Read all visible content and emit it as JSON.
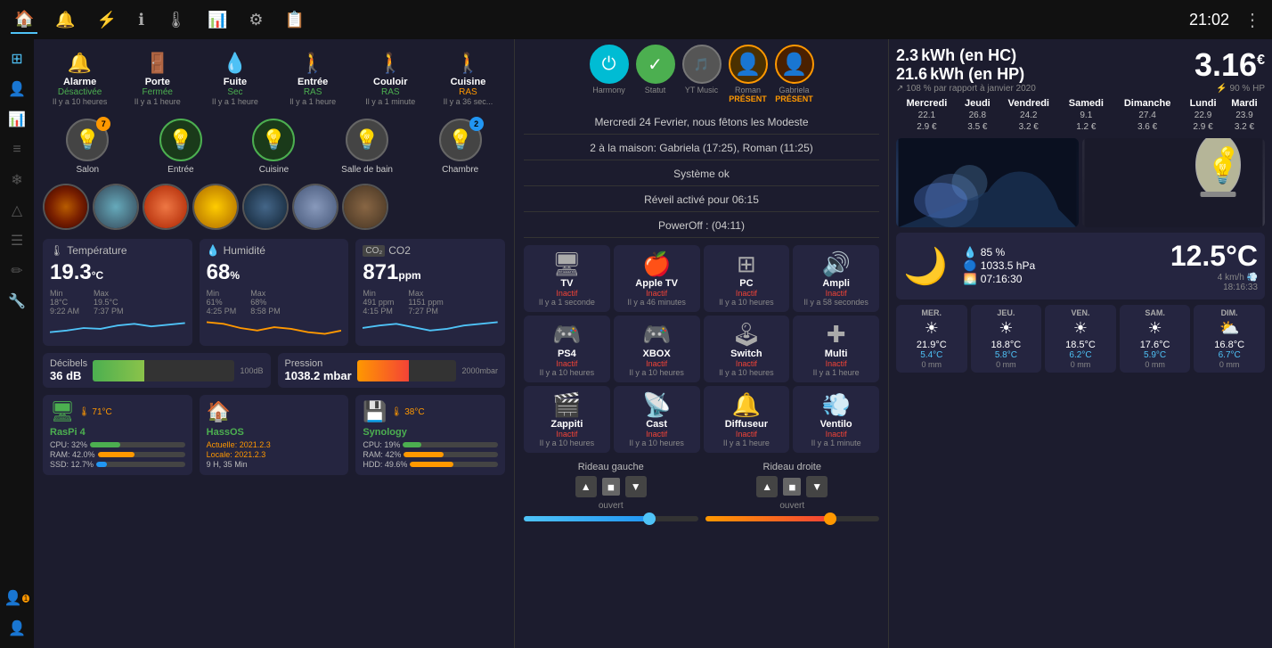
{
  "topnav": {
    "time": "21:02",
    "icons": [
      "🏠",
      "🔔",
      "⚡",
      "ℹ",
      "🌡",
      "📊",
      "⚙",
      "📋"
    ],
    "active_index": 0
  },
  "sidebar": {
    "icons": [
      "⊞",
      "👤",
      "📊",
      "≡",
      "❄",
      "△",
      "☰",
      "✏",
      "🔧",
      "👤2",
      "👤3"
    ]
  },
  "alarms": [
    {
      "icon": "🔔",
      "name": "Alarme",
      "status": "Désactivée",
      "status_class": "green",
      "time": "Il y a 10 heures"
    },
    {
      "icon": "🚪",
      "name": "Porte",
      "status": "Fermée",
      "status_class": "green",
      "time": "Il y a 1 heure"
    },
    {
      "icon": "💧",
      "name": "Fuite",
      "status": "Sec",
      "status_class": "green",
      "time": "Il y a 1 heure"
    },
    {
      "icon": "🚶",
      "name": "Entrée",
      "status": "RAS",
      "status_class": "green",
      "time": "Il y a 1 heure"
    },
    {
      "icon": "🚶",
      "name": "Couloir",
      "status": "RAS",
      "status_class": "green",
      "time": "Il y a 1 minute"
    },
    {
      "icon": "🚶",
      "name": "Cuisine",
      "status": "RAS",
      "status_class": "orange",
      "time": "Il y a 36 sec..."
    }
  ],
  "bulbs": [
    {
      "name": "Salon",
      "badge": "7",
      "badge_class": "orange",
      "lit": false
    },
    {
      "name": "Entrée",
      "badge": "",
      "lit": true
    },
    {
      "name": "Cuisine",
      "badge": "",
      "lit": true
    },
    {
      "name": "Salle de bain",
      "badge": "",
      "lit": false
    },
    {
      "name": "Chambre",
      "badge": "2",
      "badge_class": "blue",
      "lit": false
    }
  ],
  "sensors": {
    "temperature": {
      "title": "Température",
      "icon": "🌡",
      "value": "19.3",
      "unit": "°C",
      "min_val": "18°C",
      "max_val": "19.5°C",
      "min_time": "9:22 AM",
      "max_time": "7:37 PM"
    },
    "humidity": {
      "title": "Humidité",
      "icon": "💧",
      "value": "68",
      "unit": "%",
      "min_val": "61%",
      "max_val": "68%",
      "min_time": "4:25 PM",
      "max_time": "8:58 PM"
    },
    "co2": {
      "title": "CO2",
      "icon": "CO₂",
      "value": "871",
      "unit": "ppm",
      "min_val": "491 ppm",
      "max_val": "1151 ppm",
      "min_time": "4:15 PM",
      "max_time": "7:27 PM"
    }
  },
  "decibels": {
    "label": "Décibels",
    "value": "36 dB",
    "bar_pct": 36,
    "max_label": "100dB"
  },
  "pression": {
    "label": "Pression",
    "value": "1038.2 mbar",
    "bar_pct": 52,
    "max_label": "2000mbar"
  },
  "systems": [
    {
      "name": "RasPi 4",
      "temp": "71°C",
      "temp_icon": "🌡",
      "cpu_label": "CPU: 32%",
      "cpu_pct": 32,
      "cpu_class": "green",
      "ram_label": "RAM: 42.0%",
      "ram_pct": 42,
      "ram_class": "orange",
      "ssd_label": "SSD: 12.7%",
      "ssd_pct": 12,
      "ssd_class": "blue"
    },
    {
      "name": "HassOS",
      "icon": "🏠",
      "line1": "Actuelle: 2021.2.3",
      "line2": "Locale: 2021.2.3",
      "line3": "9 H, 35 Min"
    },
    {
      "name": "Synology",
      "temp": "38°C",
      "temp_icon": "🌡",
      "cpu_label": "CPU: 19%",
      "cpu_pct": 19,
      "cpu_class": "green",
      "ram_label": "RAM: 42%",
      "ram_pct": 42,
      "ram_class": "orange",
      "hdd_label": "HDD: 49.6%",
      "hdd_pct": 49,
      "hdd_class": "orange"
    }
  ],
  "center": {
    "users": [
      {
        "label": "Harmony",
        "icon": "⏻",
        "class": "teal"
      },
      {
        "label": "Statut",
        "icon": "✓",
        "class": "green-bg"
      },
      {
        "label": "YT Music",
        "icon": "🎵",
        "class": "gray"
      },
      {
        "label": "Roman",
        "icon": "👤",
        "class": "present",
        "present": true
      },
      {
        "label": "Gabriela",
        "icon": "👤",
        "class": "present",
        "present": true
      }
    ],
    "messages": [
      "Mercredi 24 Fevrier, nous fêtons les Modeste",
      "2 à la maison: Gabriela (17:25), Roman (11:25)",
      "Système ok",
      "Réveil activé pour 06:15",
      "PowerOff : (04:11)"
    ],
    "devices": [
      {
        "icon": "🖥",
        "name": "TV",
        "status": "Inactif",
        "status_class": "red",
        "time": "Il y a 1 seconde"
      },
      {
        "icon": "🍎",
        "name": "Apple TV",
        "status": "Inactif",
        "status_class": "red",
        "time": "Il y a 46 minutes"
      },
      {
        "icon": "⊞",
        "name": "PC",
        "status": "Inactif",
        "status_class": "red",
        "time": "Il y a 10 heures"
      },
      {
        "icon": "📻",
        "name": "Ampli",
        "status": "Inactif",
        "status_class": "red",
        "time": "Il y a 58 secondes"
      },
      {
        "icon": "🎮",
        "name": "PS4",
        "status": "Inactif",
        "status_class": "red",
        "time": "Il y a 10 heures"
      },
      {
        "icon": "🎮",
        "name": "XBOX",
        "status": "Inactif",
        "status_class": "red",
        "time": "Il y a 10 heures"
      },
      {
        "icon": "🎮",
        "name": "Switch",
        "status": "Inactif",
        "status_class": "red",
        "time": "Il y a 10 heures"
      },
      {
        "icon": "✚",
        "name": "Multi",
        "status": "Inactif",
        "status_class": "red",
        "time": "Il y a 1 heure"
      },
      {
        "icon": "🎬",
        "name": "Zappiti",
        "status": "Inactif",
        "status_class": "red",
        "time": "Il y a 10 heures"
      },
      {
        "icon": "📡",
        "name": "Cast",
        "status": "Inactif",
        "status_class": "red",
        "time": "Il y a 10 heures"
      },
      {
        "icon": "📻",
        "name": "Diffuseur",
        "status": "Inactif",
        "status_class": "red",
        "time": "Il y a 1 heure"
      },
      {
        "icon": "💨",
        "name": "Ventilo",
        "status": "Inactif",
        "status_class": "red",
        "time": "Il y a 1 minute"
      }
    ],
    "curtain_left": {
      "title": "Rideau gauche",
      "status": "ouvert",
      "slider_pct": 72
    },
    "curtain_right": {
      "title": "Rideau droite",
      "status": "ouvert",
      "slider_pct": 72
    }
  },
  "right": {
    "energy": {
      "kwh_hc": "2.3",
      "kwh_hp": "21.6",
      "kwh_hc_label": "kWh (en HC)",
      "kwh_hp_label": "kWh (en HP)",
      "total": "3.16",
      "currency": "€",
      "pct_label": "↗ 108 % par rapport à janvier 2020",
      "pct_right": "⚡ 90 % HP",
      "days": [
        "Mercredi",
        "Jeudi",
        "Vendredi",
        "Samedi",
        "Dimanche",
        "Lundi",
        "Mardi"
      ],
      "row1": [
        "22.1",
        "26.8",
        "24.2",
        "9.1",
        "27.4",
        "22.9",
        "23.9"
      ],
      "row2": [
        "2.9 €",
        "3.5 €",
        "3.2 €",
        "1.2 €",
        "3.6 €",
        "2.9 €",
        "3.2 €"
      ]
    },
    "weather": {
      "temp": "12.5",
      "unit": "°C",
      "humidity": "85 %",
      "pressure": "1033.5 hPa",
      "sunrise": "07:16:30",
      "wind": "4 km/h",
      "wind_label2": "km",
      "time": "18:16:33",
      "forecast": [
        {
          "day": "MER.",
          "icon": "☀",
          "high": "21.9°C",
          "low": "5.4°C",
          "rain": "0 mm"
        },
        {
          "day": "JEU.",
          "icon": "☀",
          "high": "18.8°C",
          "low": "5.8°C",
          "rain": "0 mm"
        },
        {
          "day": "VEN.",
          "icon": "☀",
          "high": "18.5°C",
          "low": "6.2°C",
          "rain": "0 mm"
        },
        {
          "day": "SAM.",
          "icon": "☀",
          "high": "17.6°C",
          "low": "5.9°C",
          "rain": "0 mm"
        },
        {
          "day": "DIM.",
          "icon": "⛅",
          "high": "16.8°C",
          "low": "6.7°C",
          "rain": "0 mm"
        }
      ]
    }
  }
}
